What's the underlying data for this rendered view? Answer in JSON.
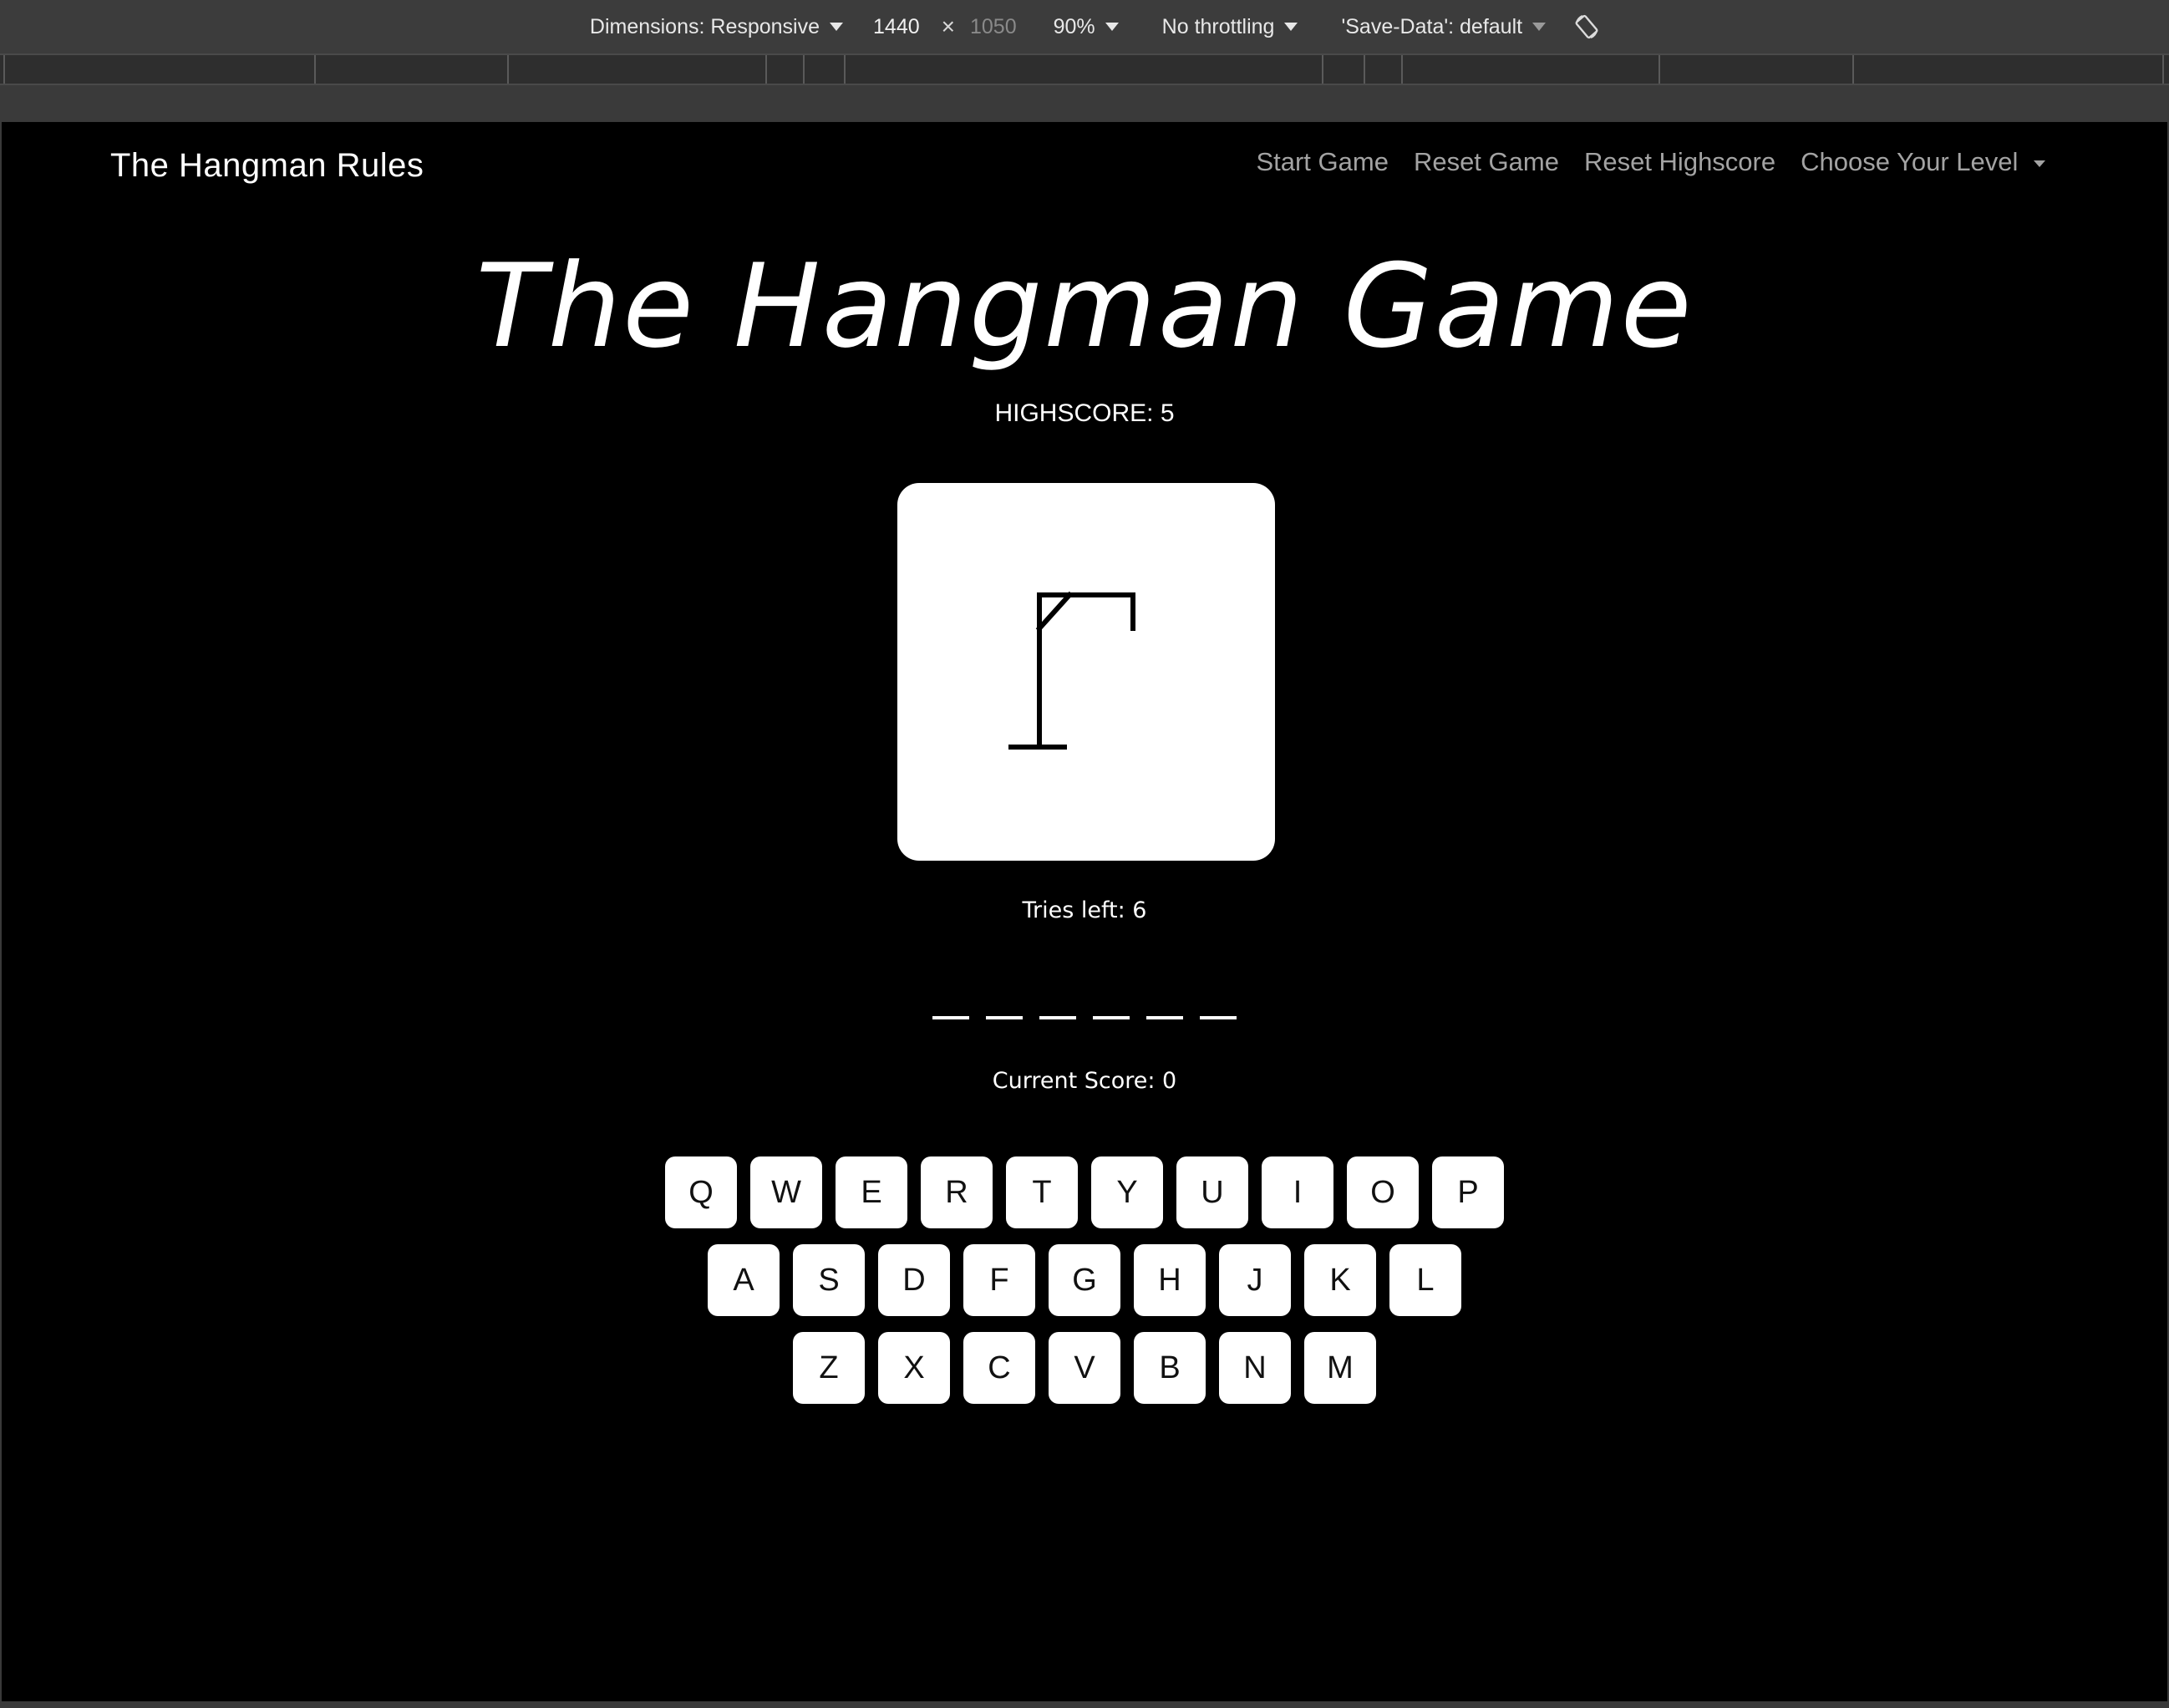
{
  "devtools": {
    "dimensions_label": "Dimensions: Responsive",
    "width_value": "1440",
    "times": "×",
    "height_placeholder": "1050",
    "zoom": "90%",
    "throttling": "No throttling",
    "save_data": "'Save-Data': default"
  },
  "navbar": {
    "brand": "The Hangman Rules",
    "links": [
      "Start Game",
      "Reset Game",
      "Reset Highscore",
      "Choose Your Level"
    ]
  },
  "game": {
    "title": "The Hangman Game",
    "highscore": "HIGHSCORE: 5",
    "tries_left": "Tries left: 6",
    "word_slots": 6,
    "current_score": "Current Score: 0"
  },
  "keyboard": {
    "row1": [
      "Q",
      "W",
      "E",
      "R",
      "T",
      "Y",
      "U",
      "I",
      "O",
      "P"
    ],
    "row2": [
      "A",
      "S",
      "D",
      "F",
      "G",
      "H",
      "J",
      "K",
      "L"
    ],
    "row3": [
      "Z",
      "X",
      "C",
      "V",
      "B",
      "N",
      "M"
    ]
  }
}
